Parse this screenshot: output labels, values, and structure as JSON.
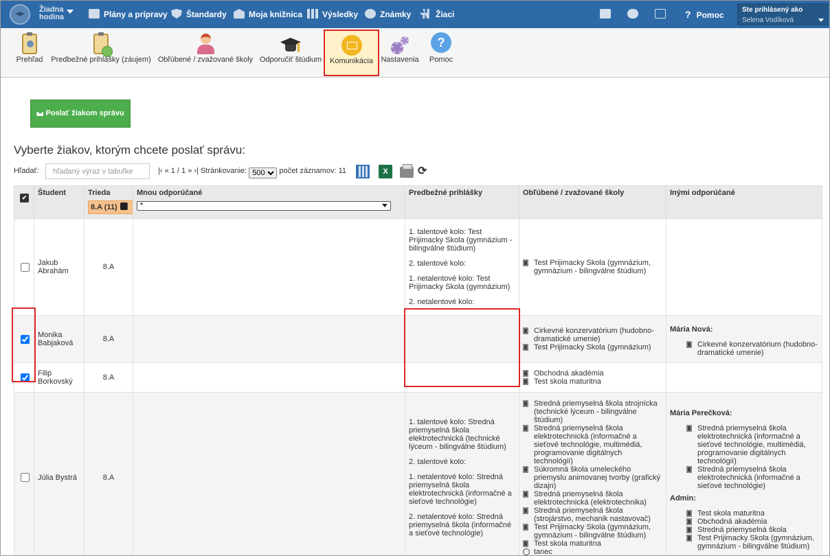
{
  "topbar": {
    "lesson": [
      "Žiadna",
      "hodina"
    ],
    "nav": [
      {
        "id": "plany",
        "label": "Plány a prípravy",
        "icon": "book-icon"
      },
      {
        "id": "standardy",
        "label": "Štandardy",
        "icon": "shield-icon"
      },
      {
        "id": "kniznica",
        "label": "Moja knižnica",
        "icon": "bank-icon"
      },
      {
        "id": "vysledky",
        "label": "Výsledky",
        "icon": "bar-chart-icon"
      },
      {
        "id": "znamky",
        "label": "Známky",
        "icon": "badge-icon"
      },
      {
        "id": "ziaci",
        "label": "Žiaci",
        "icon": "students-icon"
      }
    ],
    "help": "Pomoc",
    "help_symbol": "?",
    "user_label": "Ste prihlásený ako",
    "user_name": "Selena Vodíková"
  },
  "toolbar": [
    {
      "id": "prehlad",
      "label": "Prehľad",
      "icon": "clipboard-person-icon"
    },
    {
      "id": "prihlasky",
      "label": "Predbežné prihlášky (záujem)",
      "icon": "clipboard-check-icon"
    },
    {
      "id": "oblubene",
      "label": "Obľúbené / zvažované školy",
      "icon": "person-icon"
    },
    {
      "id": "odporucit",
      "label": "Odporučiť štúdium",
      "icon": "graduation-cap-icon"
    },
    {
      "id": "komunikacia",
      "label": "Komunikácia",
      "icon": "envelope-icon",
      "active": true
    },
    {
      "id": "nastavenia",
      "label": "Nastavenia",
      "icon": "gears-icon"
    },
    {
      "id": "pomoc",
      "label": "Pomoc",
      "icon": "question-icon",
      "symbol": "?"
    }
  ],
  "send_button": "Poslať žiakom správu",
  "heading": "Vyberte žiakov, ktorým chcete poslať správu:",
  "search": {
    "label": "Hľadať:",
    "placeholder": "hľadaný výraz v tabuľke"
  },
  "pager": {
    "nav": "|‹ « 1 / 1 » ›|",
    "paging_label": "Stránkovanie:",
    "page_size": "500",
    "count_label": "počet záznamov: 11"
  },
  "excel_letter": "X",
  "refresh_symbol": "⟳",
  "table": {
    "headers": {
      "student": "Študent",
      "trieda": "Trieda",
      "mnou": "Mnou odporúčané",
      "prihlasky": "Predbežné prihlášky",
      "oblubene": "Obľúbené / zvažované školy",
      "inymi": "Inými odporúčané"
    },
    "filter_trieda": "8.A (11)",
    "filter_mnou": "*",
    "rows": [
      {
        "name": "Jakub Abrahám",
        "class": "8.A",
        "checked": false,
        "prihlasky": [
          "1. talentové kolo: Test Prijimacky Skola (gymnázium - bilingválne štúdium)",
          "2. talentové kolo:",
          "1. netalentové kolo: Test Prijimacky Skola (gymnázium)",
          "2. netalentové kolo:"
        ],
        "oblubene": [
          "Test Prijimacky Skola (gymnázium, gymnázium - bilingválne štúdium)"
        ],
        "inymi": []
      },
      {
        "name": "Monika Babjaková",
        "class": "8.A",
        "checked": true,
        "prihlasky": [],
        "oblubene": [
          "Cirkevné konzervatórium (hudobno-dramatické umenie)",
          "Test Prijimacky Skola (gymnázium)"
        ],
        "inymi": [
          {
            "by": "Mária Nová:",
            "schools": [
              "Cirkevné konzervatórium (hudobno-dramatické umenie)"
            ]
          }
        ]
      },
      {
        "name": "Filip Borkovský",
        "class": "8.A",
        "checked": true,
        "prihlasky": [],
        "oblubene": [
          "Obchodná akadémia",
          "Test skola maturitna"
        ],
        "inymi": []
      },
      {
        "name": "Júlia Bystrá",
        "class": "8.A",
        "checked": false,
        "prihlasky": [
          "1. talentové kolo: Stredná priemyselná škola elektrotechnická (technické lýceum - bilingválne štúdium)",
          "2. talentové kolo:",
          "1. netalentové kolo: Stredná priemyselná škola elektrotechnická (informačné a sieťové technológie)",
          "2. netalentové kolo: Stredná priemyselná škola (informačné a sieťové technológie)"
        ],
        "oblubene": [
          "Stredná priemyselná škola strojnícka (technické lýceum - bilingválne štúdium)",
          "Stredná priemyselná škola elektrotechnická (informačné a sieťové technológie, multimédiá, programovanie digitálnych technológií)",
          "Súkromná škola umeleckého priemyslu animovanej tvorby (grafický dizajn)",
          "Stredná priemyselná škola elektrotechnická (elektrotechnika)",
          "Stredná priemyselná škola (strojárstvo, mechanik nastavovač)",
          "Test Prijimacky Skola (gymnázium, gymnázium - bilingválne štúdium)",
          "Test skola maturitna",
          "tanec"
        ],
        "inymi": [
          {
            "by": "Mária Perečková:",
            "schools": [
              "Stredná priemyselná škola elektrotechnická (informačné a sieťové technológie, multimédiá, programovanie digitálnych technológií)",
              "Stredná priemyselná škola elektrotechnická (informačné a sieťové technológie)"
            ]
          },
          {
            "by": "Admin:",
            "schools": [
              "Test skola maturitna",
              "Obchodná akadémia",
              "Stredná priemyselná škola",
              "Test Prijimacky Skola (gymnázium, gymnázium - bilingválne štúdium)"
            ]
          }
        ]
      }
    ]
  }
}
